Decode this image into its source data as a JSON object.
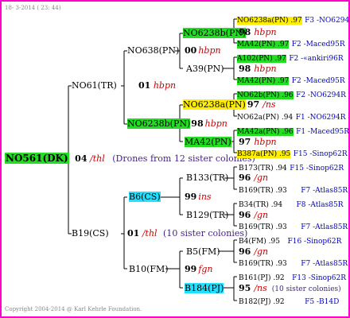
{
  "header": "18-  3-2014 ( 23: 44)",
  "footer": "Copyright 2004-2014 @ Karl Kehrle Foundation.",
  "root": {
    "id": "NO561(DK)",
    "year": "04",
    "queen": "/thl",
    "note": "(Drones from 12 sister colonies)"
  },
  "g1": [
    {
      "id": "NO61(TR)",
      "year": "01",
      "queen": "hbpn"
    },
    {
      "id": "B19(CS)",
      "year": "01",
      "queen": "/thl",
      "note": "(10 sister colonies)"
    }
  ],
  "g2": [
    {
      "id": "NO638(PN)",
      "year": "00",
      "queen": "hbpn"
    },
    {
      "id": "NO6238b(PN)",
      "year": "98",
      "queen": "hbpn"
    },
    {
      "id": "B6(CS)",
      "year": "99",
      "queen": "ins"
    },
    {
      "id": "B10(FM)",
      "year": "99",
      "queen": "fgn"
    }
  ],
  "g3": [
    {
      "id": "NO6238b(PN)"
    },
    {
      "id": "A39(PN)"
    },
    {
      "id": "NO6238a(PN)",
      "year": "97",
      "queen": "/ns"
    },
    {
      "id": "MA42(PN)",
      "year": "97",
      "queen": "hbpn"
    },
    {
      "id": "B133(TR)",
      "year": "96",
      "queen": "/gn"
    },
    {
      "id": "B129(TR)",
      "year": "96",
      "queen": "/gn"
    },
    {
      "id": "B5(FM)",
      "year": "96",
      "queen": "/gn"
    },
    {
      "id": "B184(PJ)",
      "year": "95",
      "queen": "/ns",
      "note": "(10 sister colonies)"
    }
  ],
  "g4": [
    {
      "id": "NO6238a(PN) .97",
      "src": "F3 -NO6294R"
    },
    {
      "id": "98",
      "queen": "hbpn"
    },
    {
      "id": "MA42(PN) .97",
      "src": "F2 -Maced95R"
    },
    {
      "id": "A102(PN) .97",
      "src": "F2 -«ankiri96R"
    },
    {
      "id": "98",
      "queen": "hbpn"
    },
    {
      "id": "MA42(PN) .97",
      "src": "F2 -Maced95R"
    },
    {
      "id": "NO62b(PN) .96",
      "src": "F2 -NO6294R"
    },
    {
      "id": "NO62a(PN) .94",
      "src": "F1 -NO6294R"
    },
    {
      "id": "MA42a(PN) .96",
      "src": "F1 -Maced95R"
    },
    {
      "id": "B387a(PN) .95",
      "src": "F15 -Sinop62R"
    },
    {
      "id": "B173(TR) .94",
      "src": "F15 -Sinop62R"
    },
    {
      "id": "B169(TR) .93",
      "src": "F7 -Atlas85R"
    },
    {
      "id": "B34(TR) .94",
      "src": "F8 -Atlas85R"
    },
    {
      "id": "B169(TR) .93",
      "src": "F7 -Atlas85R"
    },
    {
      "id": "B4(FM) .95",
      "src": "F16 -Sinop62R"
    },
    {
      "id": "B169(TR) .93",
      "src": "F7 -Atlas85R"
    },
    {
      "id": "B161(PJ) .92",
      "src": "F13 -Sinop62R"
    },
    {
      "id": "B182(PJ) .92",
      "src": "F5 -B14D"
    }
  ]
}
